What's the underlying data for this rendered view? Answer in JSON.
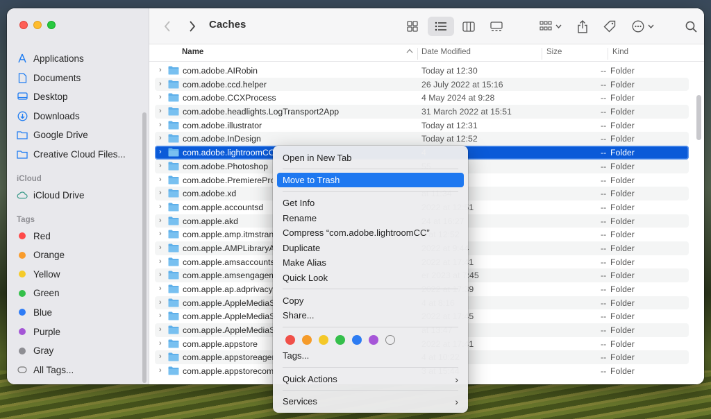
{
  "toolbar": {
    "title": "Caches"
  },
  "sidebar": {
    "favorites": [
      {
        "label": "Applications",
        "icon": "applications-icon"
      },
      {
        "label": "Documents",
        "icon": "document-icon"
      },
      {
        "label": "Desktop",
        "icon": "desktop-icon"
      },
      {
        "label": "Downloads",
        "icon": "downloads-icon"
      },
      {
        "label": "Google Drive",
        "icon": "folder-icon"
      },
      {
        "label": "Creative Cloud Files...",
        "icon": "folder-icon"
      }
    ],
    "icloud_header": "iCloud",
    "icloud_drive": "iCloud Drive",
    "tags_header": "Tags",
    "tags": [
      {
        "label": "Red",
        "color": "#fe4a49"
      },
      {
        "label": "Orange",
        "color": "#f99c2c"
      },
      {
        "label": "Yellow",
        "color": "#f5cb2a"
      },
      {
        "label": "Green",
        "color": "#34c04a"
      },
      {
        "label": "Blue",
        "color": "#2e7cf6"
      },
      {
        "label": "Purple",
        "color": "#a455d6"
      },
      {
        "label": "Gray",
        "color": "#8e8e93"
      }
    ],
    "all_tags": "All Tags..."
  },
  "columns": {
    "name": "Name",
    "date": "Date Modified",
    "size": "Size",
    "kind": "Kind"
  },
  "rows": [
    {
      "name": "com.adobe.AIRobin",
      "date": "Today at 12:30",
      "size": "--",
      "kind": "Folder"
    },
    {
      "name": "com.adobe.ccd.helper",
      "date": "26 July 2022 at 15:16",
      "size": "--",
      "kind": "Folder"
    },
    {
      "name": "com.adobe.CCXProcess",
      "date": "4 May 2024 at 9:28",
      "size": "--",
      "kind": "Folder"
    },
    {
      "name": "com.adobe.headlights.LogTransport2App",
      "date": "31 March 2022 at 15:51",
      "size": "--",
      "kind": "Folder"
    },
    {
      "name": "com.adobe.illustrator",
      "date": "Today at 12:31",
      "size": "--",
      "kind": "Folder"
    },
    {
      "name": "com.adobe.InDesign",
      "date": "Today at 12:52",
      "size": "--",
      "kind": "Folder"
    },
    {
      "name": "com.adobe.lightroomCC",
      "date": "4",
      "size": "--",
      "kind": "Folder"
    },
    {
      "name": "com.adobe.Photoshop",
      "date": "55",
      "size": "--",
      "kind": "Folder"
    },
    {
      "name": "com.adobe.PremierePro",
      "date": "20",
      "size": "--",
      "kind": "Folder"
    },
    {
      "name": "com.adobe.xd",
      "date": "at 11:34",
      "size": "--",
      "kind": "Folder"
    },
    {
      "name": "com.apple.accountsd",
      "date": "2022 at 12:51",
      "size": "--",
      "kind": "Folder"
    },
    {
      "name": "com.apple.akd",
      "date": "24 at 16:27",
      "size": "--",
      "kind": "Folder"
    },
    {
      "name": "com.apple.amp.itmstran",
      "date": "2 at 12:52",
      "size": "--",
      "kind": "Folder"
    },
    {
      "name": "com.apple.AMPLibraryA",
      "date": "2022 at 9:44",
      "size": "--",
      "kind": "Folder"
    },
    {
      "name": "com.apple.amsaccounts",
      "date": "2022 at 17:41",
      "size": "--",
      "kind": "Folder"
    },
    {
      "name": "com.apple.amsengagem",
      "date": "er 2023 at 7:45",
      "size": "--",
      "kind": "Folder"
    },
    {
      "name": "com.apple.ap.adprivacy",
      "date": "2022 at 17:39",
      "size": "--",
      "kind": "Folder"
    },
    {
      "name": "com.apple.AppleMediaS",
      "date": "4 at 8:16",
      "size": "--",
      "kind": "Folder"
    },
    {
      "name": "com.apple.AppleMediaS",
      "date": "2022 at 17:45",
      "size": "--",
      "kind": "Folder"
    },
    {
      "name": "com.apple.AppleMediaS",
      "date": "at 13:47",
      "size": "--",
      "kind": "Folder"
    },
    {
      "name": "com.apple.appstore",
      "date": "2022 at 17:41",
      "size": "--",
      "kind": "Folder"
    },
    {
      "name": "com.apple.appstoreager",
      "date": "4 at 10:22",
      "size": "--",
      "kind": "Folder"
    },
    {
      "name": "com.apple.appstorecom",
      "date": "3 at 15:44",
      "size": "--",
      "kind": "Folder"
    }
  ],
  "menu": {
    "open_new_tab": "Open in New Tab",
    "move_to_trash": "Move to Trash",
    "get_info": "Get Info",
    "rename": "Rename",
    "compress": "Compress “com.adobe.lightroomCC”",
    "duplicate": "Duplicate",
    "make_alias": "Make Alias",
    "quick_look": "Quick Look",
    "copy": "Copy",
    "share": "Share...",
    "tags": "Tags...",
    "quick_actions": "Quick Actions",
    "services": "Services",
    "tag_colors": [
      "#f05049",
      "#f59b2a",
      "#f4c828",
      "#35bf4b",
      "#2d7cf2",
      "#a656d8"
    ]
  }
}
